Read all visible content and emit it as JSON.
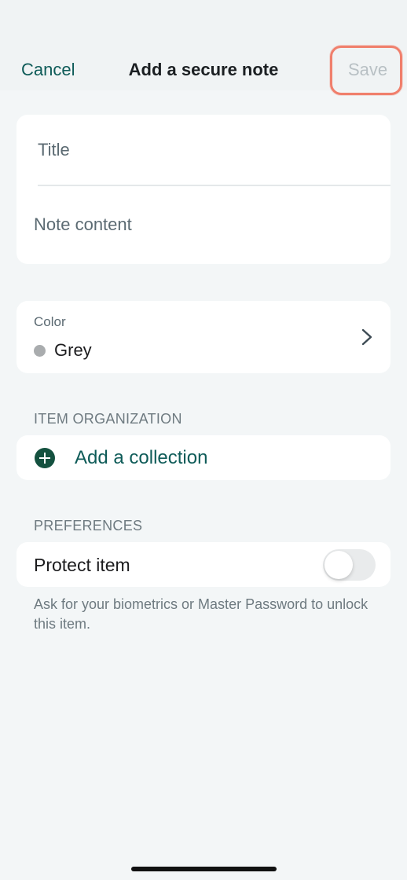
{
  "nav": {
    "cancel_label": "Cancel",
    "title": "Add a secure note",
    "save_label": "Save"
  },
  "note": {
    "title_placeholder": "Title",
    "content_placeholder": "Note content"
  },
  "color": {
    "caption": "Color",
    "value": "Grey",
    "swatch": "#a9acae",
    "chevron_icon": "chevron-right-icon"
  },
  "organization": {
    "header": "ITEM ORGANIZATION",
    "add_collection_label": "Add a collection",
    "add_icon": "plus-circle-icon"
  },
  "preferences": {
    "header": "PREFERENCES",
    "protect_label": "Protect item",
    "protect_enabled": false,
    "footnote": "Ask for your biometrics or Master Password to unlock this item."
  },
  "colors": {
    "accent": "#0e5b58",
    "highlight": "#f07f6c",
    "background": "#f3f6f7"
  }
}
